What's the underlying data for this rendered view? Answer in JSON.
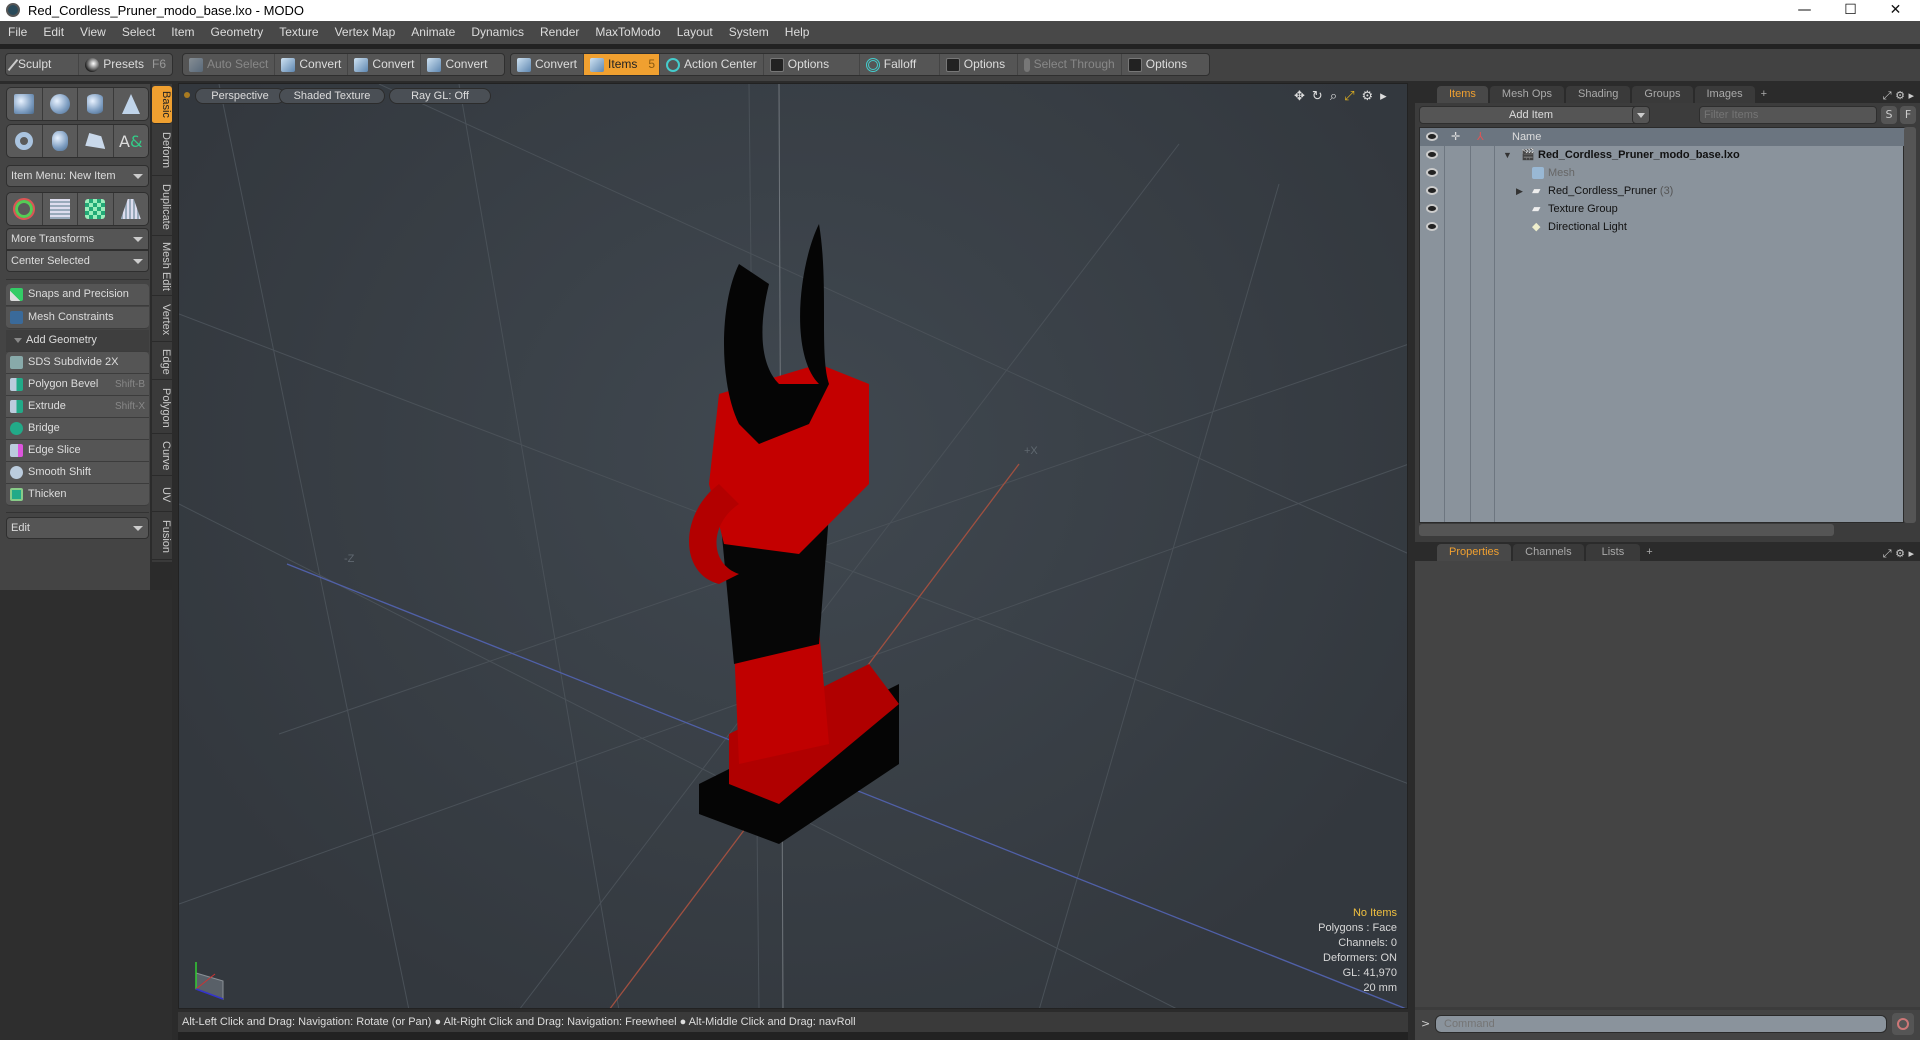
{
  "window": {
    "title": "Red_Cordless_Pruner_modo_base.lxo - MODO",
    "minimize": "—",
    "maximize": "☐",
    "close": "✕"
  },
  "menu": [
    "File",
    "Edit",
    "View",
    "Select",
    "Item",
    "Geometry",
    "Texture",
    "Vertex Map",
    "Animate",
    "Dynamics",
    "Render",
    "MaxToModo",
    "Layout",
    "System",
    "Help"
  ],
  "toolbar": {
    "sculpt": "Sculpt",
    "presets": "Presets",
    "presets_key": "F6",
    "auto_select": "Auto Select",
    "convert1": "Convert",
    "convert2": "Convert",
    "convert3": "Convert",
    "convert4": "Convert",
    "items": "Items",
    "items_key": "5",
    "action_center": "Action Center",
    "options1": "Options",
    "falloff": "Falloff",
    "options2": "Options",
    "select_through": "Select Through",
    "options3": "Options"
  },
  "left_panel": {
    "item_menu": "Item Menu: New Item",
    "more_transforms": "More Transforms",
    "center_selected": "Center Selected",
    "snaps": "Snaps and Precision",
    "mesh_constraints": "Mesh Constraints",
    "add_geometry": "Add Geometry",
    "tools": [
      {
        "label": "SDS Subdivide 2X",
        "shortcut": ""
      },
      {
        "label": "Polygon Bevel",
        "shortcut": "Shift-B"
      },
      {
        "label": "Extrude",
        "shortcut": "Shift-X"
      },
      {
        "label": "Bridge",
        "shortcut": ""
      },
      {
        "label": "Edge Slice",
        "shortcut": ""
      },
      {
        "label": "Smooth Shift",
        "shortcut": ""
      },
      {
        "label": "Thicken",
        "shortcut": ""
      }
    ],
    "edit": "Edit",
    "vtabs": [
      "Basic",
      "Deform",
      "Duplicate",
      "Mesh Edit",
      "Vertex",
      "Edge",
      "Polygon",
      "Curve",
      "UV",
      "Fusion"
    ]
  },
  "viewport": {
    "view": "Perspective",
    "shading": "Shaded Texture",
    "raygl": "Ray GL: Off",
    "axis_px": "+X",
    "axis_nz": "-Z",
    "hud": {
      "selection": "No Items",
      "polygons": "Polygons : Face",
      "channels": "Channels: 0",
      "deformers": "Deformers: ON",
      "gl": "GL: 41,970",
      "scale": "20 mm"
    },
    "colors": {
      "selection_text": "#f0c040",
      "model_red": "#c00000",
      "model_black": "#050505"
    }
  },
  "status": {
    "hint": "Alt-Left Click and Drag: Navigation: Rotate (or Pan) ● Alt-Right Click and Drag: Navigation: Freewheel ● Alt-Middle Click and Drag: navRoll"
  },
  "items_panel": {
    "tabs": [
      "Items",
      "Mesh Ops",
      "Shading",
      "Groups",
      "Images",
      "+"
    ],
    "add_item": "Add Item",
    "filter_placeholder": "Filter Items",
    "s": "S",
    "f": "F",
    "name_header": "Name",
    "tree": [
      {
        "label": "Red_Cordless_Pruner_modo_base.lxo",
        "count": ""
      },
      {
        "label": "Mesh",
        "count": ""
      },
      {
        "label": "Red_Cordless_Pruner",
        "count": "(3)"
      },
      {
        "label": "Texture Group",
        "count": ""
      },
      {
        "label": "Directional Light",
        "count": ""
      }
    ]
  },
  "properties_panel": {
    "tabs": [
      "Properties",
      "Channels",
      "Lists",
      "+"
    ]
  },
  "command": {
    "prompt": ">",
    "placeholder": "Command"
  }
}
